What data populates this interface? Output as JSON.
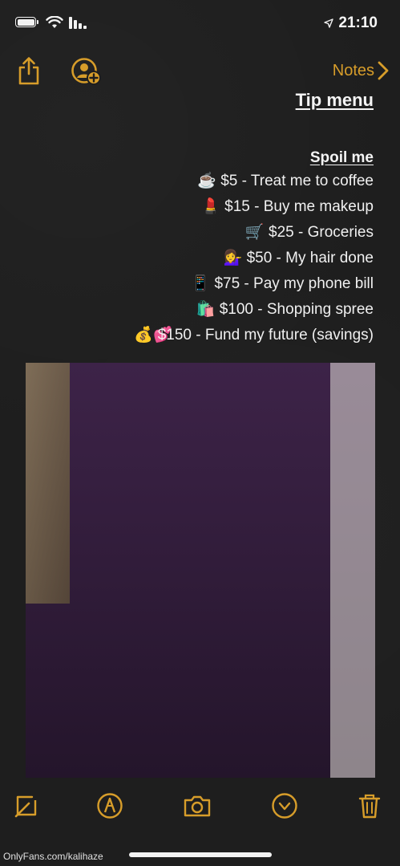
{
  "status_bar": {
    "time": "21:10",
    "icons": [
      "battery-icon",
      "wifi-icon",
      "cellular-signal-icon",
      "location-arrow-icon"
    ]
  },
  "toolbar": {
    "back_label": "Notes",
    "icons": [
      "share-icon",
      "add-person-icon",
      "chevron-left-icon"
    ]
  },
  "note": {
    "title": "Tip menu",
    "section_heading": "Spoil me",
    "items": [
      {
        "text": "$5 - Treat me to coffee",
        "emoji": "☕"
      },
      {
        "text": "$15 - Buy me makeup",
        "emoji": "💄"
      },
      {
        "text": "$25 - Groceries",
        "emoji": "🛒"
      },
      {
        "text": "$50 - My hair done",
        "emoji": "💁‍♀️"
      },
      {
        "text": "$75 - Pay my phone bill",
        "emoji": "📱"
      },
      {
        "text": "$100 - Shopping spree",
        "emoji": "🛍️"
      },
      {
        "text": "$150 - Fund my future (savings)",
        "emoji": "💰💕"
      }
    ]
  },
  "bottom_toolbar": {
    "icons": [
      "checklist-icon",
      "markup-pen-icon",
      "camera-icon",
      "chevron-circle-down-icon",
      "trash-icon"
    ]
  },
  "watermark": "OnlyFans.com/kalihaze",
  "colors": {
    "accent": "#d79d2a",
    "background": "#1e1e1e",
    "text": "#f2f2f2"
  }
}
